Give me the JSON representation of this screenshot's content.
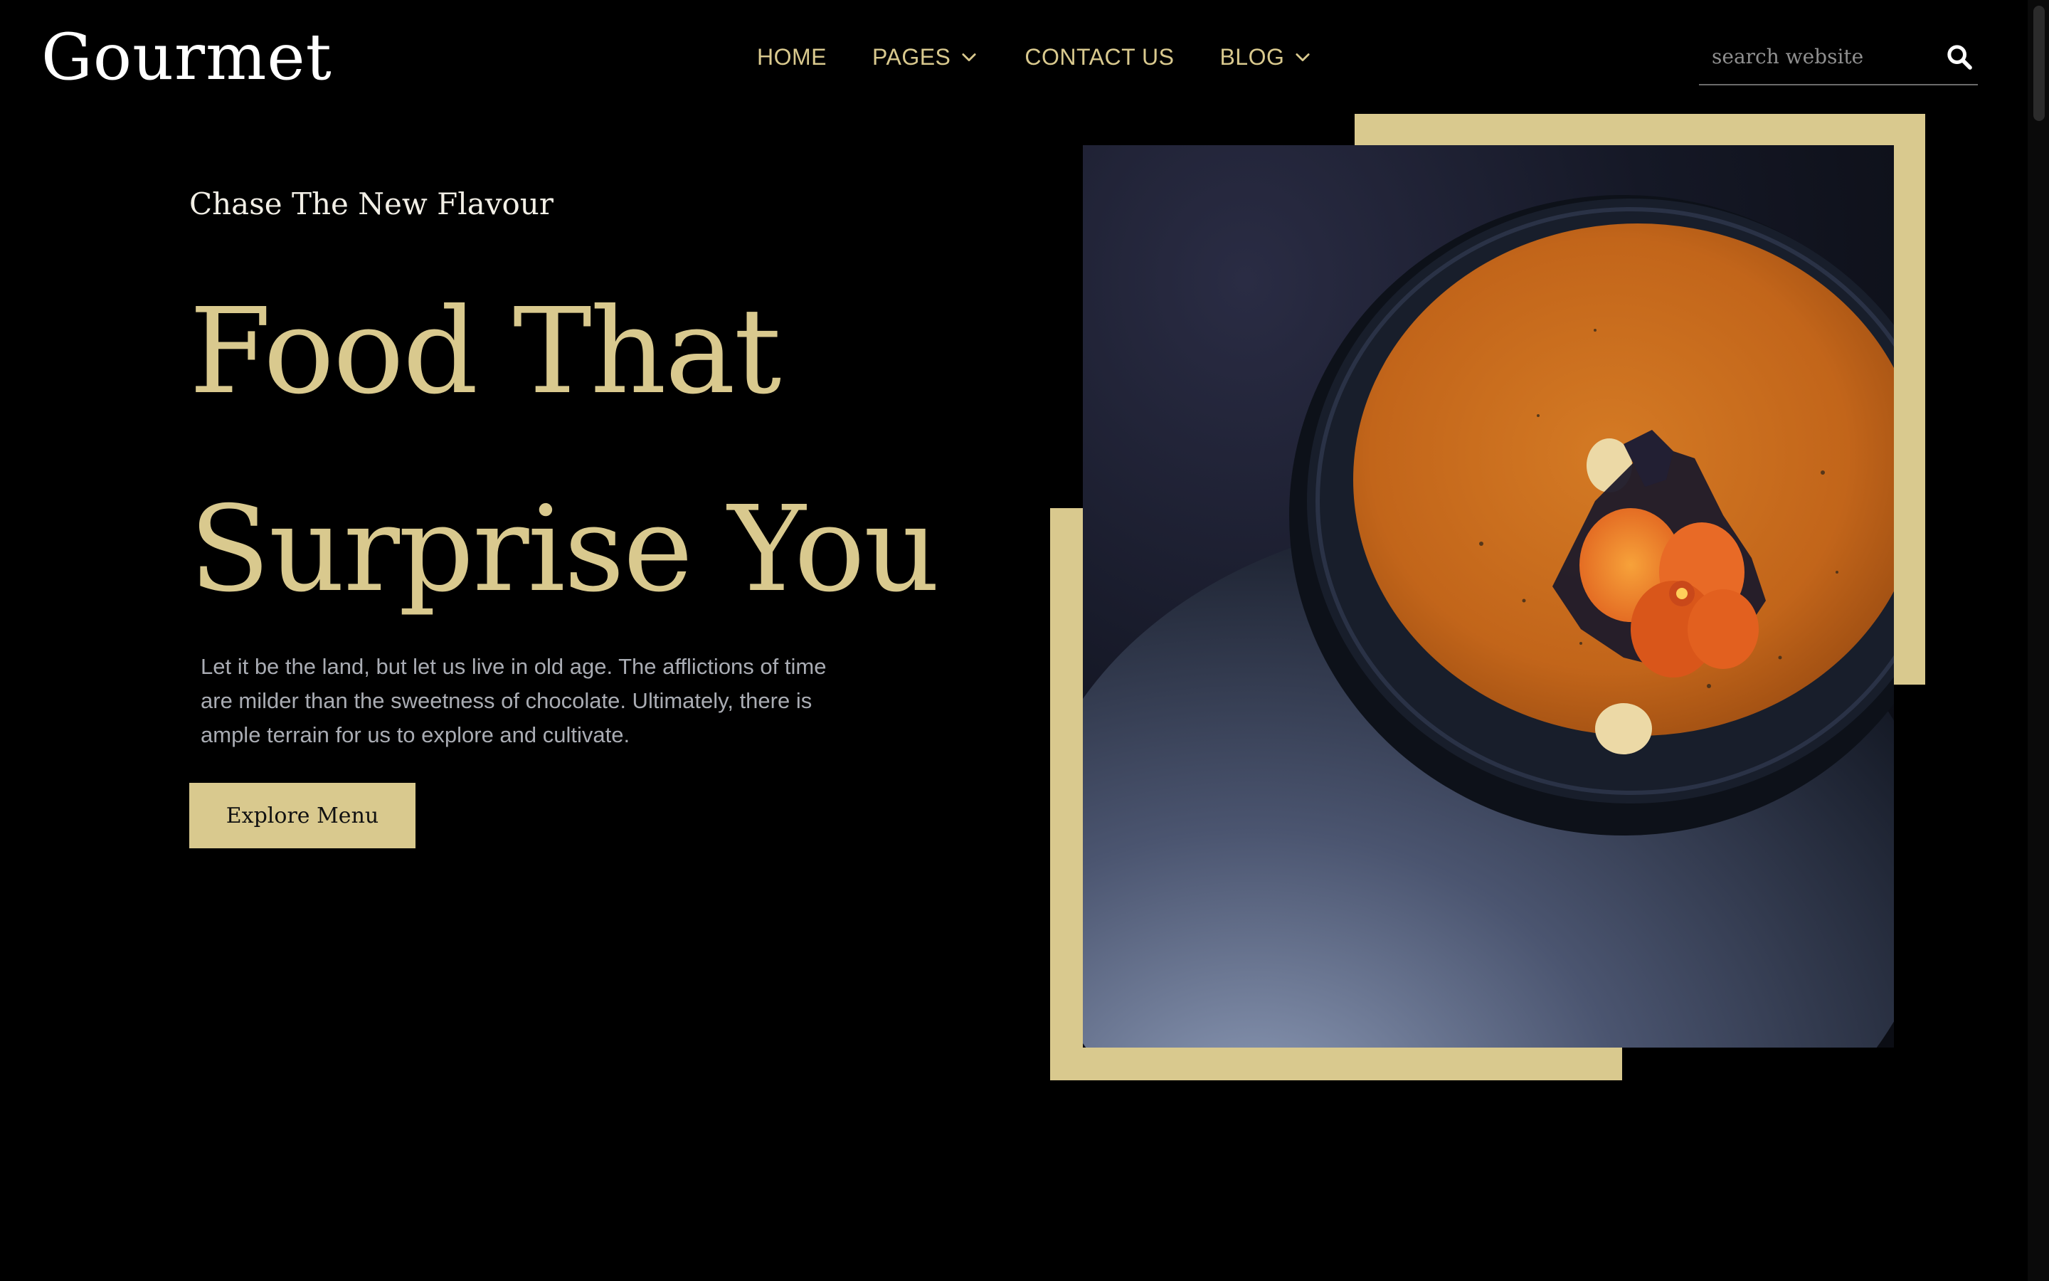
{
  "header": {
    "logo": "Gourmet",
    "nav": [
      {
        "label": "HOME",
        "has_dropdown": false
      },
      {
        "label": "PAGES",
        "has_dropdown": true
      },
      {
        "label": "CONTACT US",
        "has_dropdown": false
      },
      {
        "label": "BLOG",
        "has_dropdown": true
      }
    ],
    "search": {
      "placeholder": "search website",
      "icon": "search-icon"
    }
  },
  "hero": {
    "eyebrow": "Chase The New Flavour",
    "headline_line1": "Food That",
    "headline_line2": "Surprise You",
    "description": "Let it be the land, but let us live in old age. The afflictions of time are milder than the sweetness of chocolate. Ultimately, there is ample terrain for us to explore and cultivate.",
    "cta_label": "Explore Menu",
    "image": "soup-bowl-photo"
  },
  "colors": {
    "background": "#000000",
    "accent_gold": "#d9c98e",
    "body_text": "#a9acb3",
    "logo_text": "#ffffff"
  }
}
